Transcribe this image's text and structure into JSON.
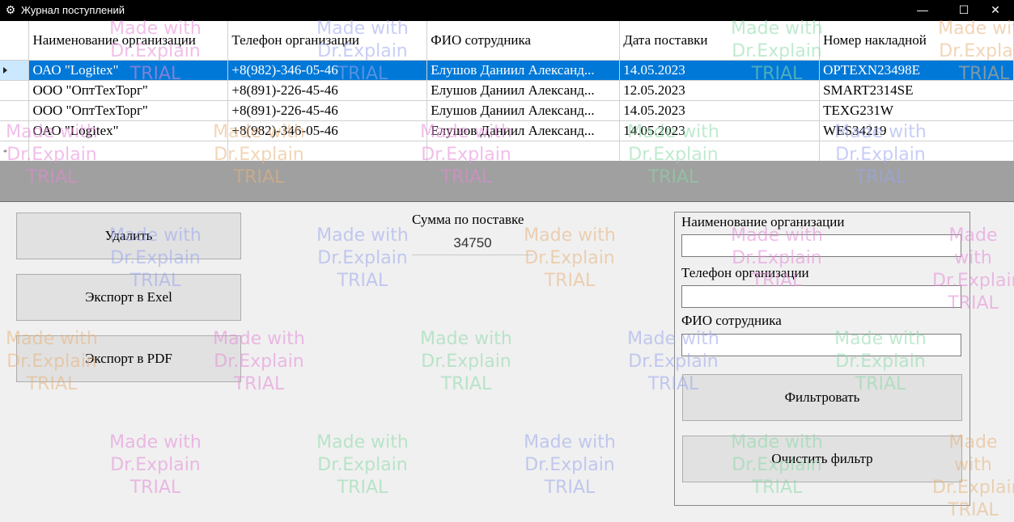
{
  "window": {
    "title": "Журнал поступлений",
    "minimize": "—",
    "maximize": "☐",
    "close": "✕"
  },
  "grid": {
    "columns": [
      "Наименование организации",
      "Телефон организации",
      "ФИО сотрудника",
      "Дата поставки",
      "Номер накладной"
    ],
    "rows": [
      [
        "ОАО \"Logitex\"",
        "+8(982)-346-05-46",
        "Елушов Даниил Александ...",
        "14.05.2023",
        "OPTEXN23498E"
      ],
      [
        "ООО \"ОптТехТорг\"",
        "+8(891)-226-45-46",
        "Елушов Даниил Александ...",
        "12.05.2023",
        "SMART2314SE"
      ],
      [
        "ООО \"ОптТехТорг\"",
        "+8(891)-226-45-46",
        "Елушов Даниил Александ...",
        "14.05.2023",
        "TEXG231W"
      ],
      [
        "ОАО \"Logitex\"",
        "+8(982)-346-05-46",
        "Елушов Даниил Александ...",
        "14.05.2023",
        "WES34219"
      ]
    ],
    "new_row_marker": "*"
  },
  "actions": {
    "delete": "Удалить",
    "export_excel": "Экспорт в Exel",
    "export_pdf": "Экспорт в PDF"
  },
  "summary": {
    "label": "Сумма по поставке",
    "value": "34750"
  },
  "filter": {
    "org_label": "Наименование организации",
    "org_value": "",
    "phone_label": "Телефон организации",
    "phone_value": "",
    "employee_label": "ФИО сотрудника",
    "employee_value": "",
    "apply": "Фильтровать",
    "clear": "Очистить фильтр"
  },
  "watermark": {
    "line1": "Made with",
    "line2": "Dr.Explain",
    "line3": "TRIAL"
  },
  "icons": {
    "app": "gear-icon",
    "row_indicator": "current-row-arrow-icon"
  }
}
